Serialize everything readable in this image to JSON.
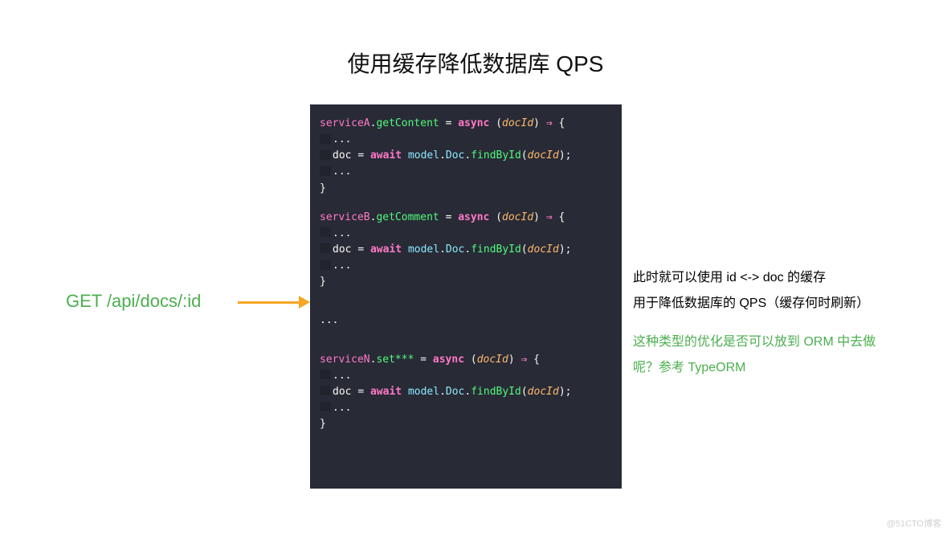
{
  "title": "使用缓存降低数据库 QPS",
  "leftLabel": "GET /api/docs/:id",
  "code": {
    "a": {
      "obj": "serviceA",
      "method": "getContent",
      "param": "docId",
      "body": {
        "var": "doc",
        "awaitKw": "await",
        "model": "model",
        "cls": "Doc",
        "fn": "findById",
        "arg": "docId"
      }
    },
    "b": {
      "obj": "serviceB",
      "method": "getComment",
      "param": "docId",
      "body": {
        "var": "doc",
        "awaitKw": "await",
        "model": "model",
        "cls": "Doc",
        "fn": "findById",
        "arg": "docId"
      }
    },
    "n": {
      "obj": "serviceN",
      "method": "set***",
      "param": "docId",
      "body": {
        "var": "doc",
        "awaitKw": "await",
        "model": "model",
        "cls": "Doc",
        "fn": "findById",
        "arg": "docId"
      }
    },
    "asyncKw": "async",
    "dots": "...",
    "ellipsis": "..."
  },
  "right": {
    "line1a": "此时就可以使用 id ",
    "line1b": " doc 的缓存",
    "ltgt": "<->",
    "line2": "用于降低数据库的 QPS（缓存何时刷新）",
    "line3": "这种类型的优化是否可以放到 ORM 中去做",
    "line4": "呢？参考 TypeORM"
  },
  "watermark": "@51CTO博客"
}
